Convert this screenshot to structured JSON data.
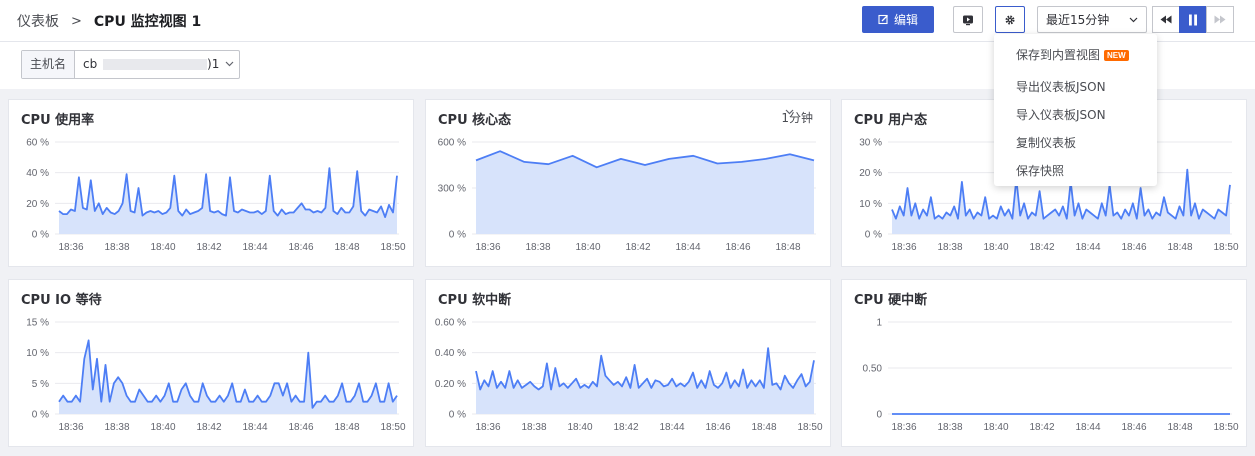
{
  "breadcrumb": {
    "root": "仪表板",
    "separator": ">",
    "current": "CPU 监控视图 1"
  },
  "toolbar": {
    "edit_label": "编辑",
    "time_range": "最近15分钟",
    "icons": [
      "edit-icon",
      "screen-icon",
      "gear-icon",
      "chevron-down-icon",
      "rewind-icon",
      "pause-icon",
      "fast-forward-icon"
    ]
  },
  "filter": {
    "label": "主机名",
    "value_prefix": "cb",
    "value_suffix": ")1"
  },
  "menu": {
    "items": [
      "保存到内置视图",
      "导出仪表板JSON",
      "导入仪表板JSON",
      "复制仪表板",
      "保存快照"
    ],
    "badge": "NEW"
  },
  "colors": {
    "accent": "#3a5ccc",
    "line": "#4d7ef5",
    "fill": "#d7e3fb",
    "badge": "#ff6a00"
  },
  "panels": [
    {
      "title": "CPU 使用率",
      "interval": ""
    },
    {
      "title": "CPU 核心态",
      "interval": "1分钟"
    },
    {
      "title": "CPU 用户态",
      "interval": ""
    },
    {
      "title": "CPU IO 等待",
      "interval": ""
    },
    {
      "title": "CPU 软中断",
      "interval": ""
    },
    {
      "title": "CPU 硬中断",
      "interval": ""
    }
  ],
  "chart_data": [
    {
      "type": "area",
      "title": "CPU 使用率",
      "x": [
        "18:36",
        "18:38",
        "18:40",
        "18:42",
        "18:44",
        "18:46",
        "18:48",
        "18:50"
      ],
      "ylim": [
        0,
        60
      ],
      "yticks": [
        "0 %",
        "20 %",
        "40 %",
        "60 %"
      ],
      "values": [
        15,
        13,
        13,
        16,
        15,
        37,
        17,
        16,
        35,
        15,
        20,
        13,
        17,
        14,
        13,
        15,
        20,
        39,
        15,
        14,
        30,
        12,
        14,
        15,
        14,
        15,
        13,
        14,
        17,
        38,
        15,
        12,
        16,
        13,
        14,
        15,
        17,
        39,
        15,
        14,
        15,
        13,
        12,
        37,
        15,
        14,
        16,
        15,
        14,
        14,
        15,
        13,
        15,
        38,
        15,
        12,
        16,
        13,
        14,
        14,
        17,
        20,
        16,
        16,
        14,
        15,
        14,
        17,
        43,
        15,
        13,
        17,
        14,
        14,
        18,
        41,
        15,
        12,
        16,
        15,
        14,
        18,
        11,
        19,
        14,
        38
      ]
    },
    {
      "type": "area",
      "title": "CPU 核心态",
      "x": [
        "18:36",
        "18:38",
        "18:40",
        "18:42",
        "18:44",
        "18:46",
        "18:48"
      ],
      "ylim": [
        0,
        600
      ],
      "yticks": [
        "0 %",
        "300 %",
        "600 %"
      ],
      "values": [
        480,
        540,
        470,
        455,
        510,
        435,
        490,
        450,
        490,
        510,
        460,
        470,
        490,
        520,
        480
      ]
    },
    {
      "type": "area",
      "title": "CPU 用户态",
      "x": [
        "18:36",
        "18:38",
        "18:40",
        "18:42",
        "18:44",
        "18:46",
        "18:48",
        "18:50"
      ],
      "ylim": [
        0,
        30
      ],
      "yticks": [
        "0 %",
        "10 %",
        "20 %",
        "30 %"
      ],
      "values": [
        8,
        5,
        9,
        6,
        15,
        6,
        10,
        5,
        8,
        6,
        12,
        5,
        6,
        5,
        7,
        6,
        9,
        5,
        17,
        6,
        8,
        5,
        7,
        6,
        12,
        5,
        6,
        5,
        9,
        6,
        8,
        5,
        18,
        6,
        10,
        5,
        7,
        6,
        14,
        5,
        6,
        7,
        8,
        6,
        9,
        5,
        17,
        6,
        10,
        5,
        8,
        7,
        6,
        5,
        10,
        6,
        16,
        6,
        7,
        5,
        8,
        6,
        10,
        5,
        15,
        6,
        8,
        5,
        7,
        6,
        12,
        7,
        6,
        5,
        9,
        6,
        21,
        6,
        10,
        5,
        8,
        7,
        6,
        5,
        8,
        7,
        6,
        16
      ]
    },
    {
      "type": "area",
      "title": "CPU IO 等待",
      "x": [
        "18:36",
        "18:38",
        "18:40",
        "18:42",
        "18:44",
        "18:46",
        "18:48",
        "18:50"
      ],
      "ylim": [
        0,
        15
      ],
      "yticks": [
        "0 %",
        "5 %",
        "10 %",
        "15 %"
      ],
      "values": [
        2,
        3,
        2,
        2,
        3,
        2,
        9,
        12,
        4,
        9,
        2,
        8,
        2,
        5,
        6,
        5,
        3,
        2,
        2,
        4,
        3,
        2,
        2,
        3,
        2,
        3,
        5,
        2,
        2,
        4,
        5,
        3,
        2,
        2,
        5,
        3,
        2,
        2,
        3,
        2,
        3,
        5,
        2,
        2,
        4,
        2,
        2,
        3,
        2,
        2,
        3,
        5,
        5,
        3,
        5,
        2,
        3,
        2,
        2,
        10,
        1,
        2,
        2,
        3,
        2,
        2,
        3,
        5,
        2,
        2,
        3,
        5,
        2,
        2,
        3,
        5,
        2,
        2,
        5,
        2,
        3
      ]
    },
    {
      "type": "area",
      "title": "CPU 软中断",
      "x": [
        "18:36",
        "18:38",
        "18:40",
        "18:42",
        "18:44",
        "18:46",
        "18:48",
        "18:50"
      ],
      "ylim": [
        0,
        0.6
      ],
      "yticks": [
        "0 %",
        "0.20 %",
        "0.40 %",
        "0.60 %"
      ],
      "values": [
        0.28,
        0.16,
        0.22,
        0.18,
        0.28,
        0.17,
        0.21,
        0.17,
        0.28,
        0.17,
        0.22,
        0.17,
        0.19,
        0.21,
        0.18,
        0.16,
        0.18,
        0.33,
        0.16,
        0.3,
        0.18,
        0.2,
        0.17,
        0.2,
        0.23,
        0.17,
        0.19,
        0.17,
        0.21,
        0.18,
        0.38,
        0.25,
        0.22,
        0.19,
        0.21,
        0.18,
        0.24,
        0.17,
        0.32,
        0.17,
        0.2,
        0.23,
        0.17,
        0.22,
        0.21,
        0.18,
        0.19,
        0.23,
        0.18,
        0.2,
        0.18,
        0.21,
        0.27,
        0.17,
        0.22,
        0.17,
        0.28,
        0.19,
        0.17,
        0.2,
        0.27,
        0.17,
        0.22,
        0.18,
        0.29,
        0.17,
        0.22,
        0.18,
        0.22,
        0.17,
        0.43,
        0.19,
        0.2,
        0.16,
        0.25,
        0.2,
        0.17,
        0.22,
        0.26,
        0.18,
        0.21,
        0.35
      ]
    },
    {
      "type": "area",
      "title": "CPU 硬中断",
      "x": [
        "18:36",
        "18:38",
        "18:40",
        "18:42",
        "18:44",
        "18:46",
        "18:48",
        "18:50"
      ],
      "ylim": [
        0,
        1
      ],
      "yticks": [
        "0",
        "0.50",
        "1"
      ],
      "values": [
        0,
        0,
        0,
        0,
        0,
        0,
        0,
        0,
        0,
        0,
        0,
        0,
        0,
        0,
        0,
        0,
        0,
        0,
        0,
        0
      ]
    }
  ]
}
